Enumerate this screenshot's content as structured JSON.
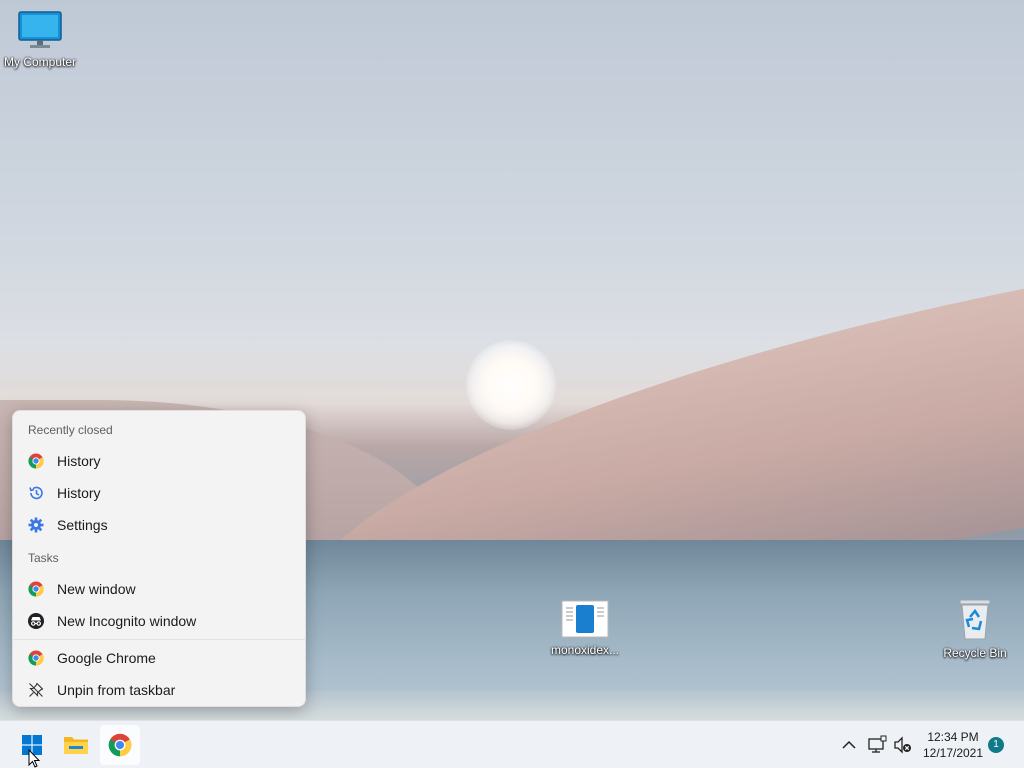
{
  "desktop": {
    "icons": [
      {
        "label": "My Computer",
        "icon": "monitor-icon"
      },
      {
        "label": "monoxidex...",
        "icon": "document-icon"
      },
      {
        "label": "Recycle Bin",
        "icon": "recycle-bin-icon"
      }
    ]
  },
  "jumplist": {
    "recently_closed_header": "Recently closed",
    "recently_closed": [
      {
        "label": "History",
        "icon": "chrome-icon"
      },
      {
        "label": "History",
        "icon": "history-icon"
      },
      {
        "label": "Settings",
        "icon": "gear-icon"
      }
    ],
    "tasks_header": "Tasks",
    "tasks": [
      {
        "label": "New window",
        "icon": "chrome-icon"
      },
      {
        "label": "New Incognito window",
        "icon": "incognito-icon"
      }
    ],
    "app": [
      {
        "label": "Google Chrome",
        "icon": "chrome-icon"
      },
      {
        "label": "Unpin from taskbar",
        "icon": "unpin-icon"
      }
    ]
  },
  "taskbar": {
    "apps": [
      {
        "name": "Start",
        "icon": "windows-start-icon"
      },
      {
        "name": "File Explorer",
        "icon": "folder-icon"
      },
      {
        "name": "Google Chrome",
        "icon": "chrome-icon"
      }
    ],
    "tray": {
      "time": "12:34 PM",
      "date": "12/17/2021",
      "notification_count": "1"
    }
  },
  "colors": {
    "accent": "#0078d4",
    "badge": "#0e7a8a"
  }
}
